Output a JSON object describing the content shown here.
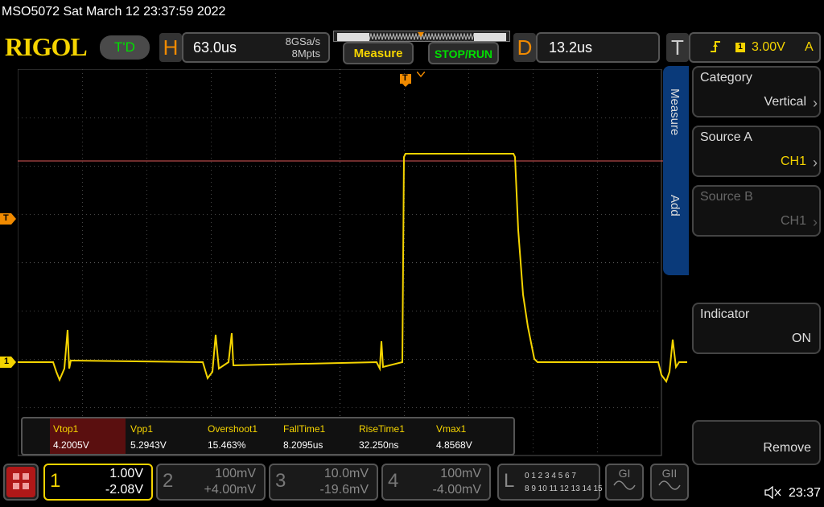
{
  "header": {
    "title": "MSO5072  Sat March 12 23:37:59 2022",
    "logo": "RIGOL",
    "trigger_state": "T'D"
  },
  "horizontal": {
    "label": "H",
    "timebase": "63.0us",
    "sample_rate": "8GSa/s",
    "memory_depth": "8Mpts"
  },
  "buttons": {
    "measure": "Measure",
    "stop_run": "STOP/RUN"
  },
  "delay": {
    "label": "D",
    "value": "13.2us"
  },
  "trigger": {
    "label": "T",
    "source": "1",
    "level": "3.00V",
    "coupling": "A"
  },
  "side_tabs": {
    "measure": "Measure",
    "add": "Add"
  },
  "menu": {
    "category_title": "Category",
    "category_value": "Vertical",
    "source_a_title": "Source A",
    "source_a_value": "CH1",
    "source_b_title": "Source B",
    "source_b_value": "CH1",
    "indicator_title": "Indicator",
    "indicator_value": "ON",
    "remove_label": "Remove"
  },
  "markers": {
    "trigger_pos": "T",
    "trigger_level": "T",
    "ch1_ground": "1"
  },
  "measurements": [
    {
      "name": "Vtop1",
      "value": "4.2005V"
    },
    {
      "name": "Vpp1",
      "value": "5.2943V"
    },
    {
      "name": "Overshoot1",
      "value": "15.463%"
    },
    {
      "name": "FallTime1",
      "value": "8.2095us"
    },
    {
      "name": "RiseTime1",
      "value": "32.250ns"
    },
    {
      "name": "Vmax1",
      "value": "4.8568V"
    }
  ],
  "channels": [
    {
      "num": "1",
      "scale": "1.00V",
      "offset": "-2.08V"
    },
    {
      "num": "2",
      "scale": "100mV",
      "offset": "+4.00mV"
    },
    {
      "num": "3",
      "scale": "10.0mV",
      "offset": "-19.6mV"
    },
    {
      "num": "4",
      "scale": "100mV",
      "offset": "-4.00mV"
    }
  ],
  "logic": {
    "label": "L",
    "row1": "0 1 2 3  4 5 6 7",
    "row2": "8 9 10 11  12 13 14 15"
  },
  "generators": {
    "g1": "GI",
    "g2": "GII"
  },
  "status": {
    "clock": "23:37"
  },
  "colors": {
    "ch1": "#f5d400",
    "trigger": "#f08a00",
    "indicator_line": "#e05a5a",
    "tab_blue": "#0a3a7a"
  }
}
